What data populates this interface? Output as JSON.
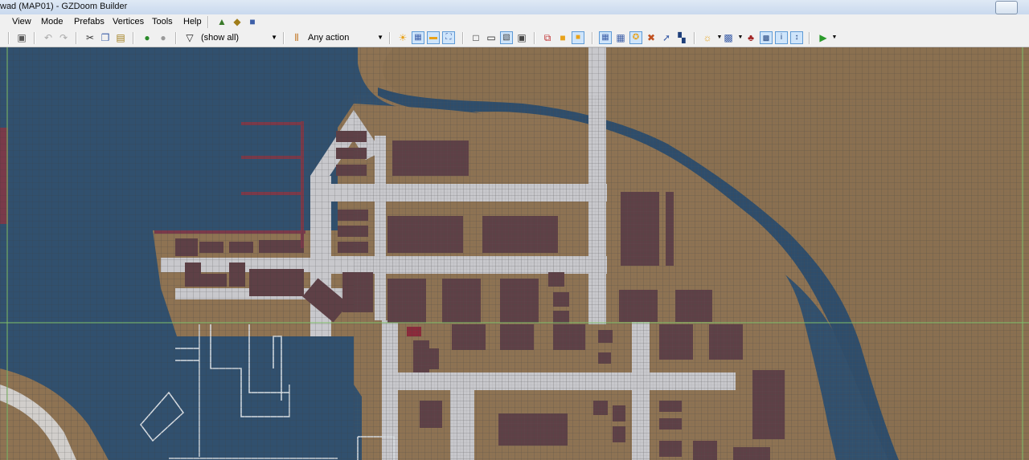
{
  "window": {
    "title": "wad (MAP01) - GZDoom Builder"
  },
  "menu": {
    "items": [
      "View",
      "Mode",
      "Prefabs",
      "Vertices",
      "Tools",
      "Help"
    ]
  },
  "toolbar": {
    "filter_value": "(show all)",
    "action_value": "Any action"
  },
  "colors": {
    "water": "#2e4d6b",
    "dirt": "#8e7353",
    "building": "#5e4046",
    "road": "#c8c8cc",
    "grid": "#4a4a4a",
    "accent": "#5e9ad6"
  }
}
